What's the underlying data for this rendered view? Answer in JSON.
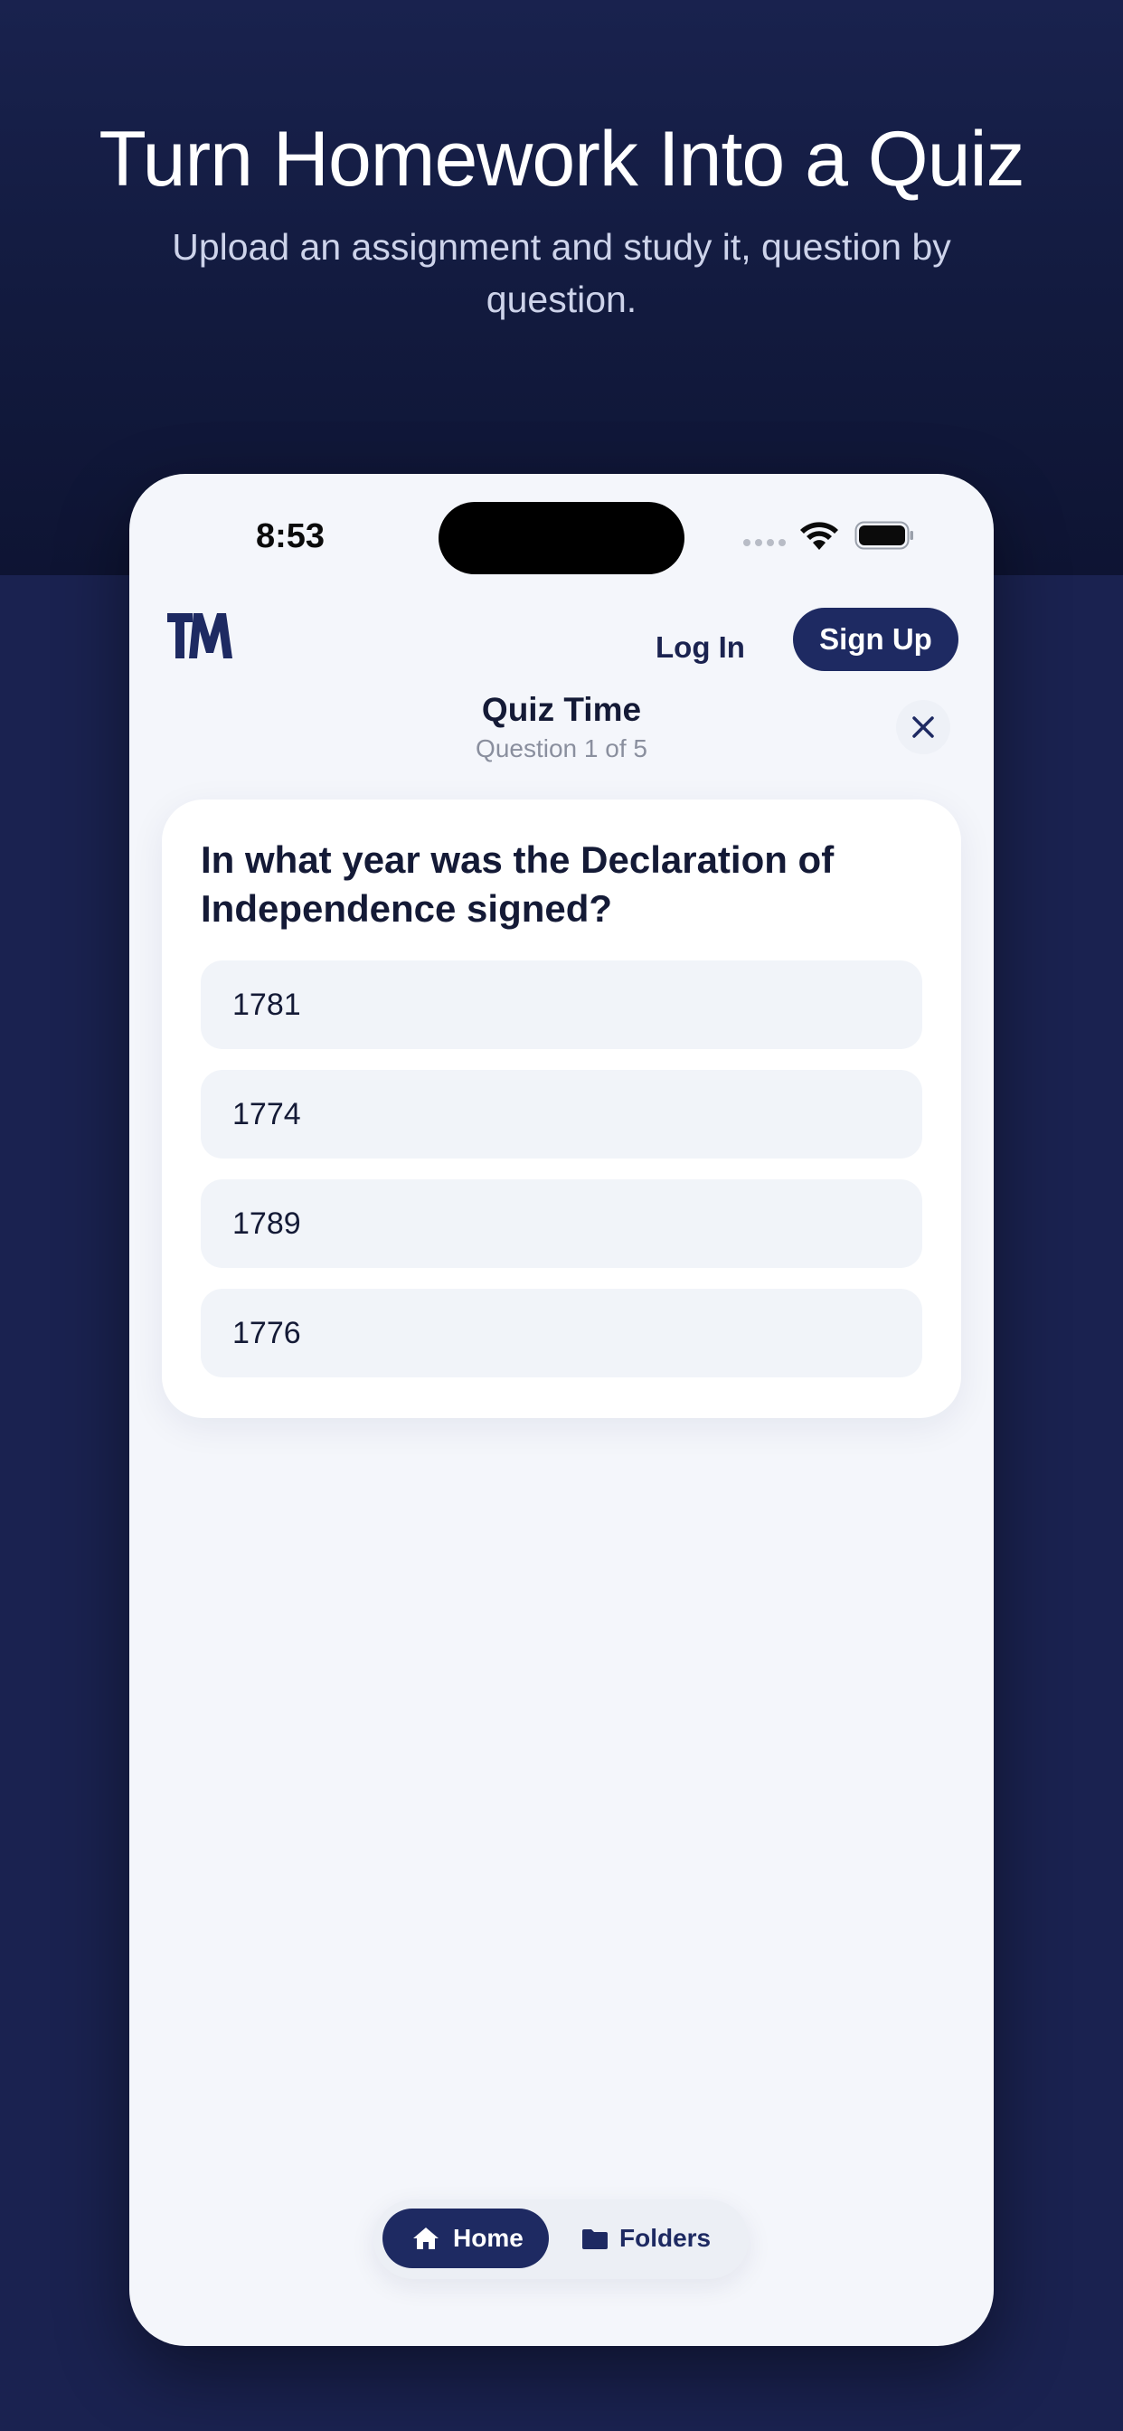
{
  "hero": {
    "title": "Turn Homework Into a Quiz",
    "subtitle": "Upload an assignment and study it, question by question."
  },
  "status_bar": {
    "time": "8:53",
    "icons": [
      "cellular-dots-icon",
      "wifi-icon",
      "battery-icon"
    ]
  },
  "header": {
    "logo_icon": "tm-logo-icon",
    "login_label": "Log In",
    "signup_label": "Sign Up"
  },
  "quiz": {
    "title": "Quiz Time",
    "progress": "Question 1 of 5",
    "close_icon": "close-icon",
    "question": "In what year was the Declaration of Independence signed?",
    "options": [
      "1781",
      "1774",
      "1789",
      "1776"
    ]
  },
  "bottom_nav": {
    "items": [
      {
        "label": "Home",
        "icon": "home-icon",
        "active": true
      },
      {
        "label": "Folders",
        "icon": "folder-icon",
        "active": false
      }
    ]
  },
  "colors": {
    "background": "#1a2250",
    "accent": "#1e2a62",
    "screen": "#f4f6fb",
    "option_bg": "#f1f4f9"
  }
}
